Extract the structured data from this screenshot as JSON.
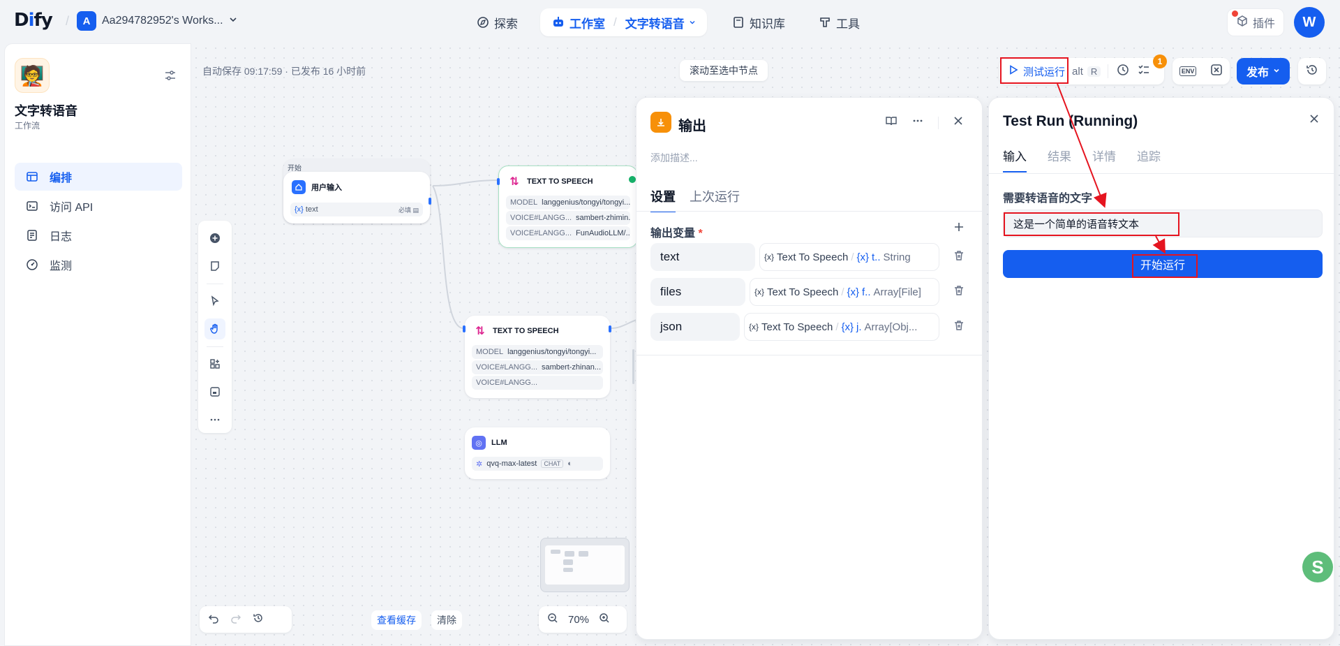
{
  "header": {
    "logo": "Dify",
    "workspace_initial": "A",
    "workspace_name": "Aa294782952's Works...",
    "nav_explore": "探索",
    "nav_studio": "工作室",
    "nav_studio_app": "文字转语音",
    "nav_knowledge": "知识库",
    "nav_tools": "工具",
    "plugins": "插件",
    "user_initial": "W"
  },
  "sidebar": {
    "app_name": "文字转语音",
    "app_type": "工作流",
    "items": [
      {
        "label": "编排",
        "icon": "layout-icon",
        "active": true
      },
      {
        "label": "访问 API",
        "icon": "terminal-icon",
        "active": false
      },
      {
        "label": "日志",
        "icon": "log-icon",
        "active": false
      },
      {
        "label": "监测",
        "icon": "monitor-icon",
        "active": false
      }
    ]
  },
  "canvas": {
    "autosave": "自动保存 09:17:59 · 已发布 16 小时前",
    "scroll_to_node": "滚动至选中节点",
    "test_run": "测试运行",
    "test_run_shortcut_1": "alt",
    "test_run_shortcut_2": "R",
    "checklist_badge": "1",
    "env_label": "ENV",
    "publish": "发布",
    "view_cache": "查看缓存",
    "clear": "清除",
    "zoom": "70%"
  },
  "nodes": {
    "start": {
      "group_label": "开始",
      "title": "用户输入",
      "var": "text",
      "required": "必填"
    },
    "tts1": {
      "title": "TEXT TO SPEECH",
      "rows": [
        {
          "k": "MODEL",
          "v": "langgenius/tongyi/tongyi..."
        },
        {
          "k": "VOICE#LANGG...",
          "v": "sambert-zhimin..."
        },
        {
          "k": "VOICE#LANGG...",
          "v": "FunAudioLLM/..."
        }
      ]
    },
    "tts2": {
      "title": "TEXT TO SPEECH",
      "rows": [
        {
          "k": "MODEL",
          "v": "langgenius/tongyi/tongyi..."
        },
        {
          "k": "VOICE#LANGG...",
          "v": "sambert-zhinan..."
        },
        {
          "k": "VOICE#LANGG...",
          "v": ""
        }
      ]
    },
    "llm": {
      "title": "LLM",
      "model": "qvq-max-latest",
      "mode": "CHAT"
    }
  },
  "output_panel": {
    "title": "输出",
    "description_placeholder": "添加描述...",
    "tab_settings": "设置",
    "tab_last_run": "上次运行",
    "vars_label": "输出变量",
    "required_mark": "*",
    "variables": [
      {
        "name": "text",
        "source": "Text To Speech",
        "var": "t..",
        "type": "String"
      },
      {
        "name": "files",
        "source": "Text To Speech",
        "var": "f..",
        "type": "Array[File]"
      },
      {
        "name": "json",
        "source": "Text To Speech",
        "var": "j.",
        "type": "Array[Obj..."
      }
    ]
  },
  "run_panel": {
    "title": "Test Run (Running)",
    "tabs": [
      "输入",
      "结果",
      "详情",
      "追踪"
    ],
    "field_label": "需要转语音的文字",
    "field_value": "这是一个简单的语音转文本",
    "start_button": "开始运行"
  },
  "colors": {
    "accent": "#155eef",
    "annotation": "#e5141f",
    "output_icon": "#f79009",
    "tts_icon": "#dd2590",
    "llm_icon": "#6172f3"
  }
}
